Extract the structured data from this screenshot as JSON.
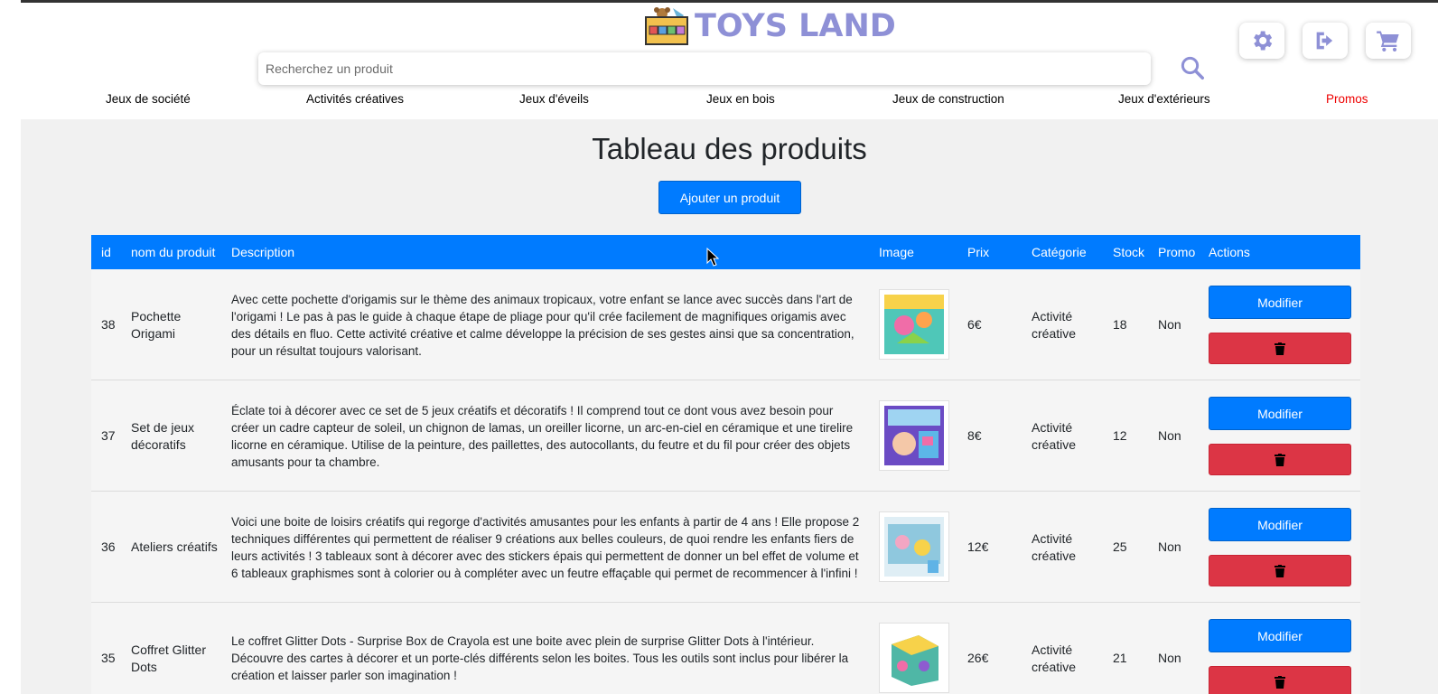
{
  "brand": {
    "name": "TOYS LAND",
    "logo_letters": "TOYS"
  },
  "header_icons": [
    {
      "name": "settings",
      "icon": "gear-icon"
    },
    {
      "name": "logout",
      "icon": "logout-icon"
    },
    {
      "name": "cart",
      "icon": "cart-icon"
    }
  ],
  "search": {
    "placeholder": "Recherchez un produit",
    "value": ""
  },
  "nav": {
    "items": [
      "Jeux de société",
      "Activités créatives",
      "Jeux d'éveils",
      "Jeux en bois",
      "Jeux de construction",
      "Jeux d'extérieurs",
      "Promos"
    ]
  },
  "page": {
    "title": "Tableau des produits",
    "add_button": "Ajouter un produit"
  },
  "table": {
    "headers": [
      "id",
      "nom du produit",
      "Description",
      "Image",
      "Prix",
      "Catégorie",
      "Stock",
      "Promo",
      "Actions"
    ],
    "modify_label": "Modifier",
    "rows": [
      {
        "id": "38",
        "name": "Pochette Origami",
        "description": "Avec cette pochette d'origamis sur le thème des animaux tropicaux, votre enfant se lance avec succès dans l'art de l'origami ! Le pas à pas le guide à chaque étape de pliage pour qu'il crée facilement de magnifiques origamis avec des détails en fluo. Cette activité créative et calme développe la précision de ses gestes ainsi que sa concentration, pour un résultat toujours valorisant.",
        "price": "6€",
        "category": "Activité créative",
        "stock": "18",
        "promo": "Non"
      },
      {
        "id": "37",
        "name": "Set de jeux décoratifs",
        "description": "Éclate toi à décorer avec ce set de 5 jeux créatifs et décoratifs ! Il comprend tout ce dont vous avez besoin pour créer un cadre capteur de soleil, un chignon de lamas, un oreiller licorne, un arc-en-ciel en céramique et une tirelire licorne en céramique. Utilise de la peinture, des paillettes, des autocollants, du feutre et du fil pour créer des objets amusants pour ta chambre.",
        "price": "8€",
        "category": "Activité créative",
        "stock": "12",
        "promo": "Non"
      },
      {
        "id": "36",
        "name": "Ateliers créatifs",
        "description": "Voici une boite de loisirs créatifs qui regorge d'activités amusantes pour les enfants à partir de 4 ans ! Elle propose 2 techniques différentes qui permettent de réaliser 9 créations aux belles couleurs, de quoi rendre les enfants fiers de leurs activités ! 3 tableaux sont à décorer avec des stickers épais qui permettent de donner un bel effet de volume et 6 tableaux graphismes sont à colorier ou à compléter avec un feutre effaçable qui permet de recommencer à l'infini !",
        "price": "12€",
        "category": "Activité créative",
        "stock": "25",
        "promo": "Non"
      },
      {
        "id": "35",
        "name": "Coffret Glitter Dots",
        "description": "Le coffret Glitter Dots - Surprise Box de Crayola est une boite avec plein de surprise Glitter Dots à l'intérieur. Découvre des cartes à décorer et un porte-clés différents selon les boites. Tous les outils sont inclus pour libérer la création et laisser parler son imagination !",
        "price": "26€",
        "category": "Activité créative",
        "stock": "21",
        "promo": "Non"
      }
    ]
  },
  "colors": {
    "primary": "#007bff",
    "danger": "#dc3545",
    "brand": "#8e90d6",
    "promo": "#ee0000"
  }
}
